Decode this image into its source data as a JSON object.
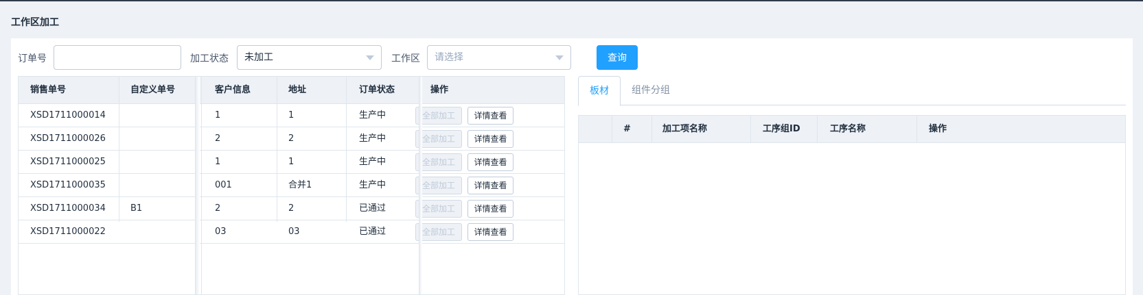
{
  "page": {
    "title": "工作区加工"
  },
  "filters": {
    "order_label": "订单号",
    "order_value": "",
    "status_label": "加工状态",
    "status_value": "未加工",
    "area_label": "工作区",
    "area_placeholder": "请选择",
    "query_label": "查询"
  },
  "left_table": {
    "headers": [
      "销售单号",
      "自定义单号",
      "客户信息",
      "地址",
      "订单状态",
      "操作"
    ],
    "action_all_label": "全部加工",
    "action_detail_label": "详情查看",
    "rows": [
      {
        "sales_no": "XSD1711000014",
        "custom_no": "",
        "customer": "1",
        "address": "1",
        "status": "生产中"
      },
      {
        "sales_no": "XSD1711000026",
        "custom_no": "",
        "customer": "2",
        "address": "2",
        "status": "生产中"
      },
      {
        "sales_no": "XSD1711000025",
        "custom_no": "",
        "customer": "1",
        "address": "1",
        "status": "生产中"
      },
      {
        "sales_no": "XSD1711000035",
        "custom_no": "",
        "customer": "001",
        "address": "合并1",
        "status": "生产中"
      },
      {
        "sales_no": "XSD1711000034",
        "custom_no": "B1",
        "customer": "2",
        "address": "2",
        "status": "已通过"
      },
      {
        "sales_no": "XSD1711000022",
        "custom_no": "",
        "customer": "03",
        "address": "03",
        "status": "已通过"
      }
    ]
  },
  "right_panel": {
    "tabs": [
      "板材",
      "组件分组"
    ],
    "headers": [
      "#",
      "加工项名称",
      "工序组ID",
      "工序名称",
      "操作"
    ]
  }
}
